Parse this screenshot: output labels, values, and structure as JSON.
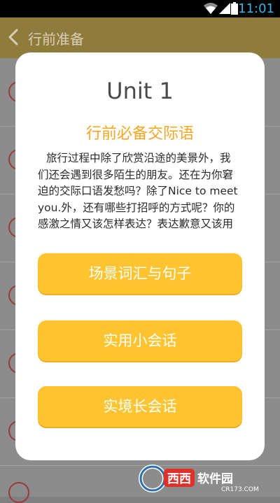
{
  "status_bar": {
    "time": "11:01"
  },
  "app_bar": {
    "title": "行前准备"
  },
  "dialog": {
    "unit_title": "Unit 1",
    "subtitle": "行前必备交际语",
    "description": "旅行过程中除了欣赏沿途的美景外，我们还会遇到很多陌生的朋友。还在为你窘迫的交际口语发愁吗？除了Nice to meet you.外，还有哪些打招呼的方式呢？你的感激之情又该怎样表达？表达歉意又该用哪些地道的句",
    "buttons": [
      {
        "label": "场景词汇与句子"
      },
      {
        "label": "实用小会话"
      },
      {
        "label": "实境长会话"
      }
    ]
  },
  "watermark": {
    "brand": "西西软件园",
    "url": "CR173.COM"
  },
  "colors": {
    "accent": "#ffc430",
    "subtitle": "#f5a623",
    "status_text": "#33b5e5"
  }
}
